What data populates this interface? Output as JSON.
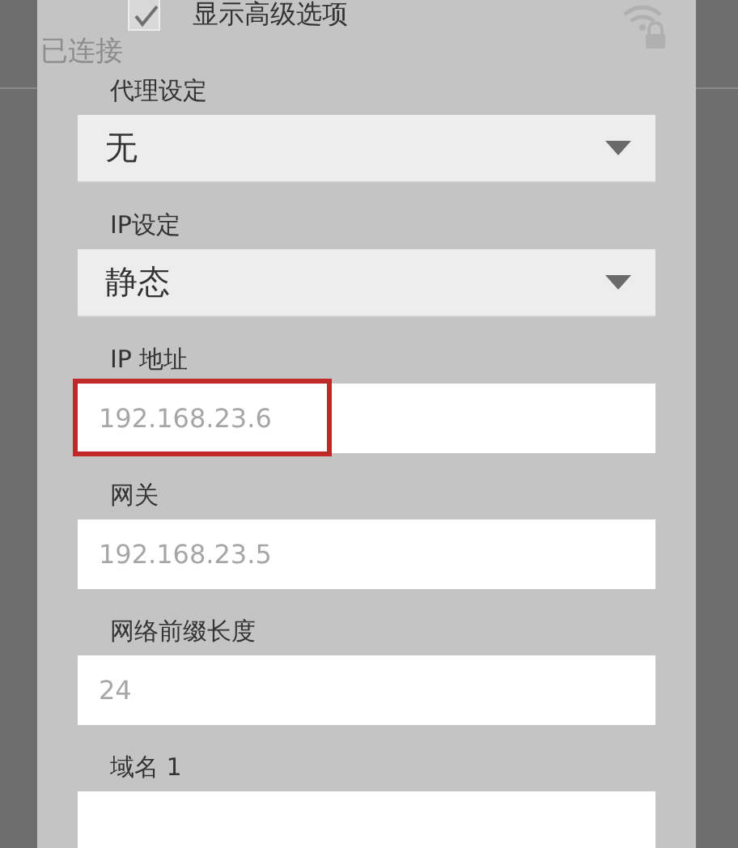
{
  "background": {
    "status": "已连接"
  },
  "dialog": {
    "advanced_options": {
      "label": "显示高级选项",
      "checked": true
    },
    "fields": [
      {
        "kind": "dropdown",
        "label": "代理设定",
        "value": "无"
      },
      {
        "kind": "dropdown",
        "label": "IP设定",
        "value": "静态"
      },
      {
        "kind": "text",
        "label": "IP 地址",
        "placeholder": "192.168.23.6",
        "highlighted": true
      },
      {
        "kind": "text",
        "label": "网关",
        "placeholder": "192.168.23.5",
        "highlighted": false
      },
      {
        "kind": "text",
        "label": "网络前缀长度",
        "placeholder": "24",
        "highlighted": false
      },
      {
        "kind": "text",
        "label": "域名 1",
        "highlighted": false
      }
    ]
  }
}
